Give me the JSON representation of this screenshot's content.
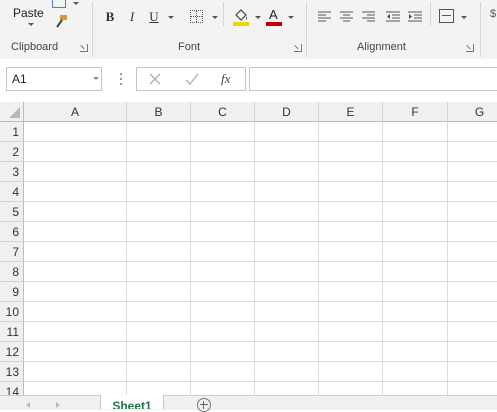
{
  "ribbon": {
    "clipboard": {
      "paste_label": "Paste",
      "group_label": "Clipboard"
    },
    "font": {
      "group_label": "Font",
      "bold": "B",
      "italic": "I",
      "underline": "U",
      "font_color_glyph": "A",
      "fill_color": "#f2d200",
      "font_color": "#c00000"
    },
    "alignment": {
      "group_label": "Alignment"
    }
  },
  "formula_bar": {
    "name_box_value": "A1",
    "fx_label": "fx",
    "formula_value": ""
  },
  "grid": {
    "columns": [
      "A",
      "B",
      "C",
      "D",
      "E",
      "F",
      "G"
    ],
    "rows": [
      "1",
      "2",
      "3",
      "4",
      "5",
      "6",
      "7",
      "8",
      "9",
      "10",
      "11",
      "12",
      "13",
      "14"
    ]
  },
  "sheets": {
    "tabs": [
      "Sheet1"
    ],
    "active": "Sheet1"
  }
}
